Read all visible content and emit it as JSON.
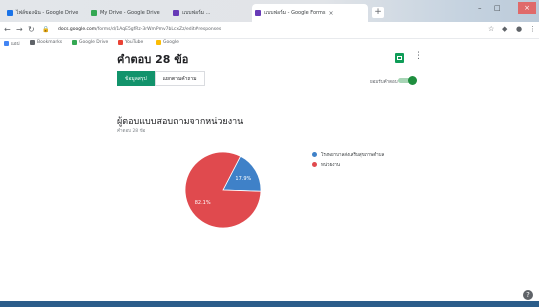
{
  "browser": {
    "tabs": [
      {
        "title": "ไฟล์ของฉัน - Google Drive",
        "favicon_color": "#1a73e8",
        "active": false
      },
      {
        "title": "My Drive - Google Drive",
        "favicon_color": "#34a853",
        "active": false
      },
      {
        "title": "แบบฟอร์ม ...",
        "favicon_color": "#673ab7",
        "active": false
      },
      {
        "title": "แบบฟอร์ม - Google Forms",
        "favicon_color": "#673ab7",
        "active": true
      }
    ],
    "new_tab": "+",
    "url_host": "docs.google.com",
    "url_path": "/forms/d/1AqE5gfRz-3rWmPmv7bLcxZz/edit#responses",
    "bookmarks": [
      {
        "label": "แอป",
        "color": "#4285f4"
      },
      {
        "label": "Bookmarks",
        "color": "#5f6368"
      },
      {
        "label": "Google Drive",
        "color": "#34a853"
      },
      {
        "label": "YouTube",
        "color": "#ea4335"
      },
      {
        "label": "Google",
        "color": "#fbbc05"
      }
    ]
  },
  "form": {
    "title": "คำตอบ 28 ข้อ",
    "tabs": [
      "ข้อมูลสรุป",
      "แยกตามคำถาม"
    ],
    "accepting_label": "ยอมรับคำตอบ",
    "question": "ผู้ตอบแบบสอบถามจากหน่วยงาน",
    "response_count": "คำตอบ 28 ข้อ",
    "accent": "#12936b"
  },
  "chart_data": {
    "type": "pie",
    "title": "",
    "series": [
      {
        "name": "โรงพยาบาลส่งเสริมสุขภาพตำบล",
        "value": 17.9,
        "color": "#3f81c8",
        "label": "17.9%"
      },
      {
        "name": "หน่วยงาน",
        "value": 82.1,
        "color": "#e04a4e",
        "label": "82.1%"
      }
    ]
  }
}
